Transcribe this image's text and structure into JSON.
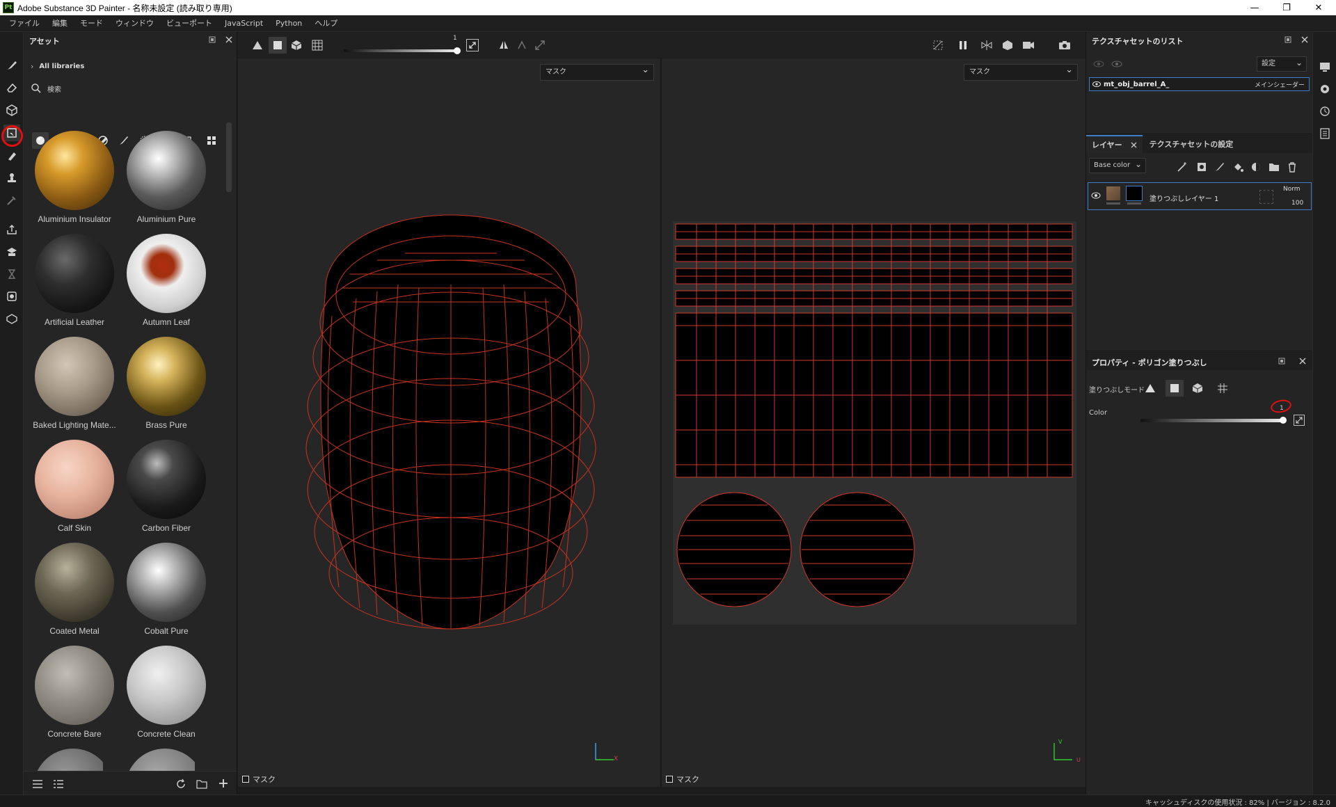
{
  "window": {
    "title": "Adobe Substance 3D Painter - 名称未設定 (読み取り専用)",
    "logo": "Pt",
    "min": "—",
    "restore": "❐",
    "close": "✕"
  },
  "menu": [
    "ファイル",
    "編集",
    "モード",
    "ウィンドウ",
    "ビューポート",
    "JavaScript",
    "Python",
    "ヘルプ"
  ],
  "assets": {
    "title": "アセット",
    "library": "All libraries",
    "search_placeholder": "検索",
    "materials": [
      "Aluminium Insulator",
      "Aluminium Pure",
      "Artificial Leather",
      "Autumn Leaf",
      "Baked Lighting Mate...",
      "Brass Pure",
      "Calf Skin",
      "Carbon Fiber",
      "Coated Metal",
      "Cobalt Pure",
      "Concrete Bare",
      "Concrete Clean"
    ]
  },
  "viewport": {
    "slider_value": "1",
    "left_dropdown": "マスク",
    "right_dropdown": "マスク",
    "left_footer": "マスク",
    "right_footer": "マスク",
    "axis_x": "X",
    "axis_v": "V",
    "axis_u": "U"
  },
  "texture_sets": {
    "title": "テクスチャセットのリスト",
    "settings_dropdown": "設定",
    "set_name": "mt_obj_barrel_A_",
    "shader": "メインシェーダー"
  },
  "layers": {
    "tab_layers": "レイヤー",
    "tab_settings": "テクスチャセットの設定",
    "channel_dropdown": "Base color",
    "layer_name": "塗りつぶしレイヤー 1",
    "blend": "Norm",
    "opacity": "100"
  },
  "properties": {
    "title": "プロパティ - ポリゴン塗りつぶし",
    "fill_mode_label": "塗りつぶしモード",
    "color_label": "Color",
    "slider_value": "1"
  },
  "status": {
    "text": "キャッシュディスクの使用状況 : 82% | バージョン : 8.2.0"
  }
}
